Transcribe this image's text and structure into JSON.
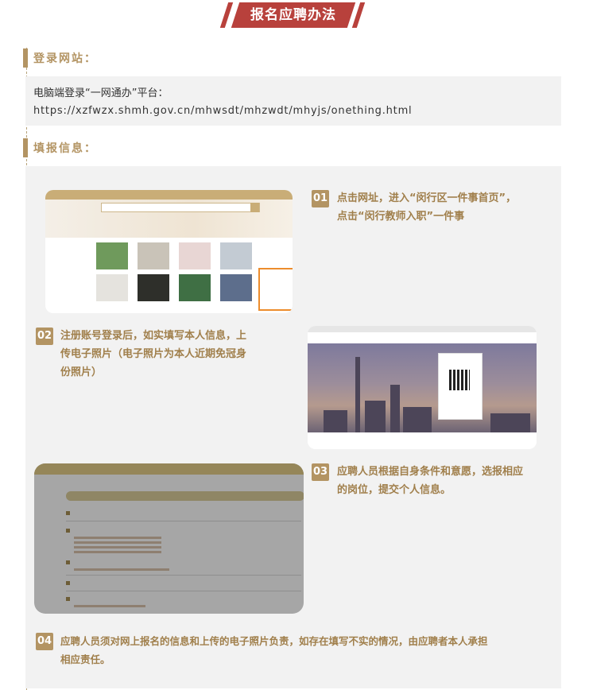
{
  "banner": {
    "title": "报名应聘办法"
  },
  "sections": {
    "login_title": "登录网站：",
    "fill_title": "填报信息："
  },
  "url_panel": {
    "line1": "电脑端登录“一网通办”平台：",
    "line2": "https://xzfwzx.shmh.gov.cn/mhwsdt/mhzwdt/mhyjs/onething.html"
  },
  "steps": [
    {
      "num": "01",
      "line1": "点击网址，进入“闵行区一件事首页”，",
      "line2": "点击“闵行教师入职”一件事"
    },
    {
      "num": "02",
      "line1": "注册账号登录后，如实填写本人信息，上",
      "line2": "传电子照片（电子照片为本人近期免冠身",
      "line3": "份照片）"
    },
    {
      "num": "03",
      "line1": "应聘人员根据自身条件和意愿，选报相应",
      "line2": "的岗位，提交个人信息。"
    },
    {
      "num": "04",
      "line1": "应聘人员须对网上报名的信息和上传的电子照片负责，如存在填写不实的情况，由应聘者本人承担",
      "line2": "相应责任。"
    }
  ],
  "colors": {
    "accent": "#b39463",
    "banner": "#b8413c",
    "panel": "#f2f2f2",
    "highlight": "#ec8c2c"
  }
}
